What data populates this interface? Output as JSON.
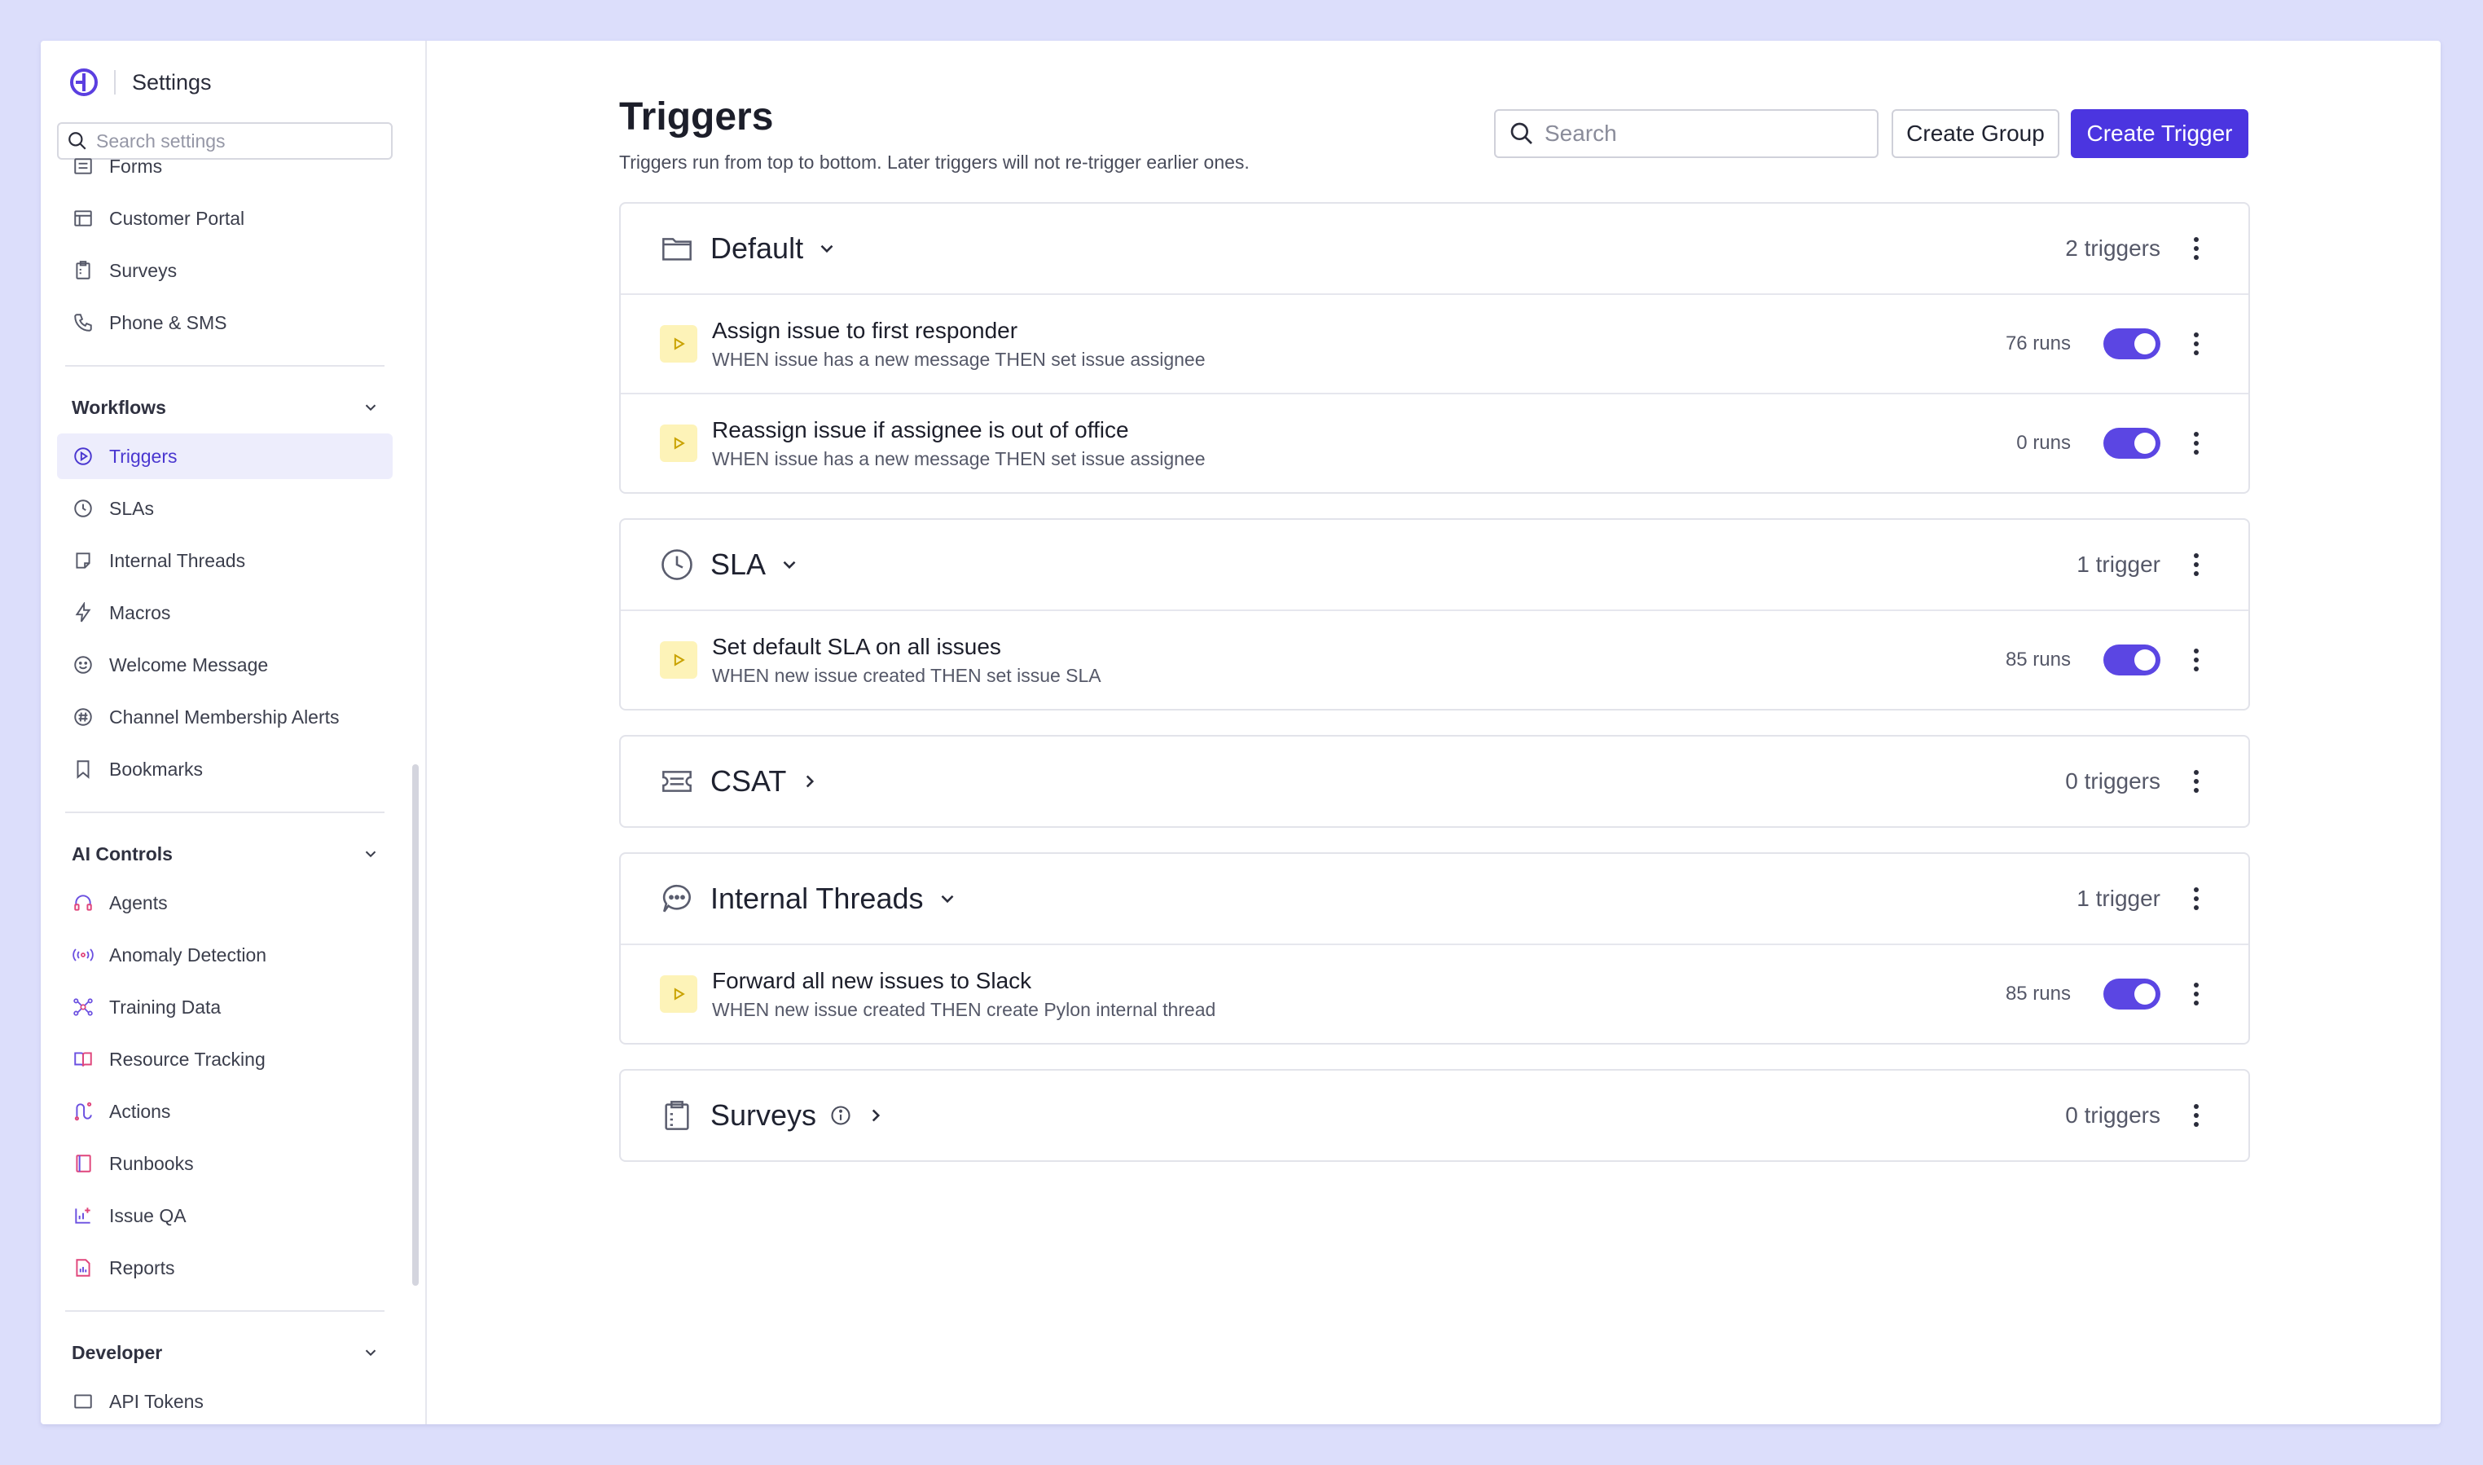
{
  "sidebar": {
    "title": "Settings",
    "search_placeholder": "Search settings",
    "top_items": [
      {
        "label": "Forms",
        "icon": "form-icon"
      },
      {
        "label": "Customer Portal",
        "icon": "portal-icon"
      },
      {
        "label": "Surveys",
        "icon": "clipboard-icon"
      },
      {
        "label": "Phone & SMS",
        "icon": "phone-icon"
      }
    ],
    "workflows": {
      "label": "Workflows",
      "items": [
        {
          "label": "Triggers",
          "icon": "play-circle-icon",
          "active": true
        },
        {
          "label": "SLAs",
          "icon": "clock-icon"
        },
        {
          "label": "Internal Threads",
          "icon": "note-icon"
        },
        {
          "label": "Macros",
          "icon": "bolt-icon"
        },
        {
          "label": "Welcome Message",
          "icon": "smile-icon"
        },
        {
          "label": "Channel Membership Alerts",
          "icon": "hash-icon"
        },
        {
          "label": "Bookmarks",
          "icon": "bookmark-icon"
        }
      ]
    },
    "ai_controls": {
      "label": "AI Controls",
      "items": [
        {
          "label": "Agents",
          "icon": "headset-icon"
        },
        {
          "label": "Anomaly Detection",
          "icon": "broadcast-icon"
        },
        {
          "label": "Training Data",
          "icon": "network-icon"
        },
        {
          "label": "Resource Tracking",
          "icon": "book-icon"
        },
        {
          "label": "Actions",
          "icon": "route-icon"
        },
        {
          "label": "Runbooks",
          "icon": "notebook-icon"
        },
        {
          "label": "Issue QA",
          "icon": "chart-plus-icon"
        },
        {
          "label": "Reports",
          "icon": "report-icon"
        }
      ]
    },
    "developer": {
      "label": "Developer",
      "items": [
        {
          "label": "API Tokens",
          "icon": "key-icon"
        }
      ]
    }
  },
  "main": {
    "title": "Triggers",
    "subtitle": "Triggers run from top to bottom. Later triggers will not re-trigger earlier ones.",
    "search_placeholder": "Search",
    "create_group_label": "Create Group",
    "create_trigger_label": "Create Trigger",
    "groups": [
      {
        "name": "Default",
        "icon": "folder-icon",
        "count": "2 triggers",
        "expanded": true,
        "triggers": [
          {
            "title": "Assign issue to first responder",
            "desc": "WHEN issue has a new message THEN set issue assignee",
            "runs": "76 runs",
            "enabled": true
          },
          {
            "title": "Reassign issue if assignee is out of office",
            "desc": "WHEN issue has a new message THEN set issue assignee",
            "runs": "0 runs",
            "enabled": true
          }
        ]
      },
      {
        "name": "SLA",
        "icon": "clock-icon",
        "count": "1 trigger",
        "expanded": true,
        "triggers": [
          {
            "title": "Set default SLA on all issues",
            "desc": "WHEN new issue created THEN set issue SLA",
            "runs": "85 runs",
            "enabled": true
          }
        ]
      },
      {
        "name": "CSAT",
        "icon": "ticket-icon",
        "count": "0 triggers",
        "expanded": false,
        "triggers": []
      },
      {
        "name": "Internal Threads",
        "icon": "chat-bubble-icon",
        "count": "1 trigger",
        "expanded": true,
        "triggers": [
          {
            "title": "Forward all new issues to Slack",
            "desc": "WHEN new issue created THEN create Pylon internal thread",
            "runs": "85 runs",
            "enabled": true
          }
        ]
      },
      {
        "name": "Surveys",
        "icon": "clipboard-icon",
        "count": "0 triggers",
        "expanded": false,
        "triggers": []
      }
    ]
  },
  "colors": {
    "accent": "#4b35e0",
    "background": "#dcdefb",
    "play_bg": "#fdf3b8",
    "active_nav_bg": "#ededfc"
  }
}
